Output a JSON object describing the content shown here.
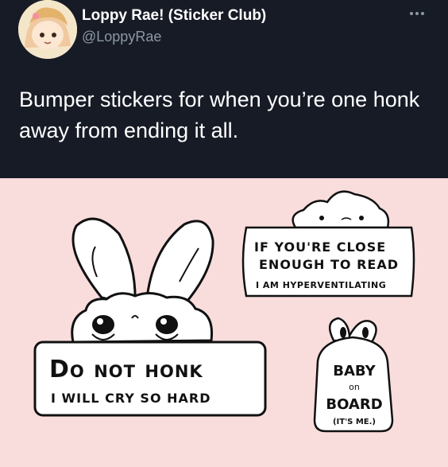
{
  "tweet": {
    "display_name": "Loppy Rae! (Sticker Club)",
    "handle": "@LoppyRae",
    "text": "Bumper stickers for when you’re one honk away from ending it all."
  },
  "colors": {
    "header_bg": "#171b26",
    "text": "#ffffff",
    "muted": "#8b98a5",
    "media_bg": "#f9dcdc",
    "sticker_fill": "#ffffff",
    "ink": "#111111"
  },
  "icons": {
    "more": "more-dots-icon"
  },
  "stickers": {
    "honk_title": "Do not honk",
    "honk_subtitle": "I will cry so hard",
    "close_line1": "If you're close",
    "close_line2": "enough to read",
    "close_line3": "I am hyperventilating",
    "baby_line1": "BABY",
    "baby_line2": "on",
    "baby_line3": "BOARD",
    "baby_line4": "(IT'S ME.)"
  }
}
